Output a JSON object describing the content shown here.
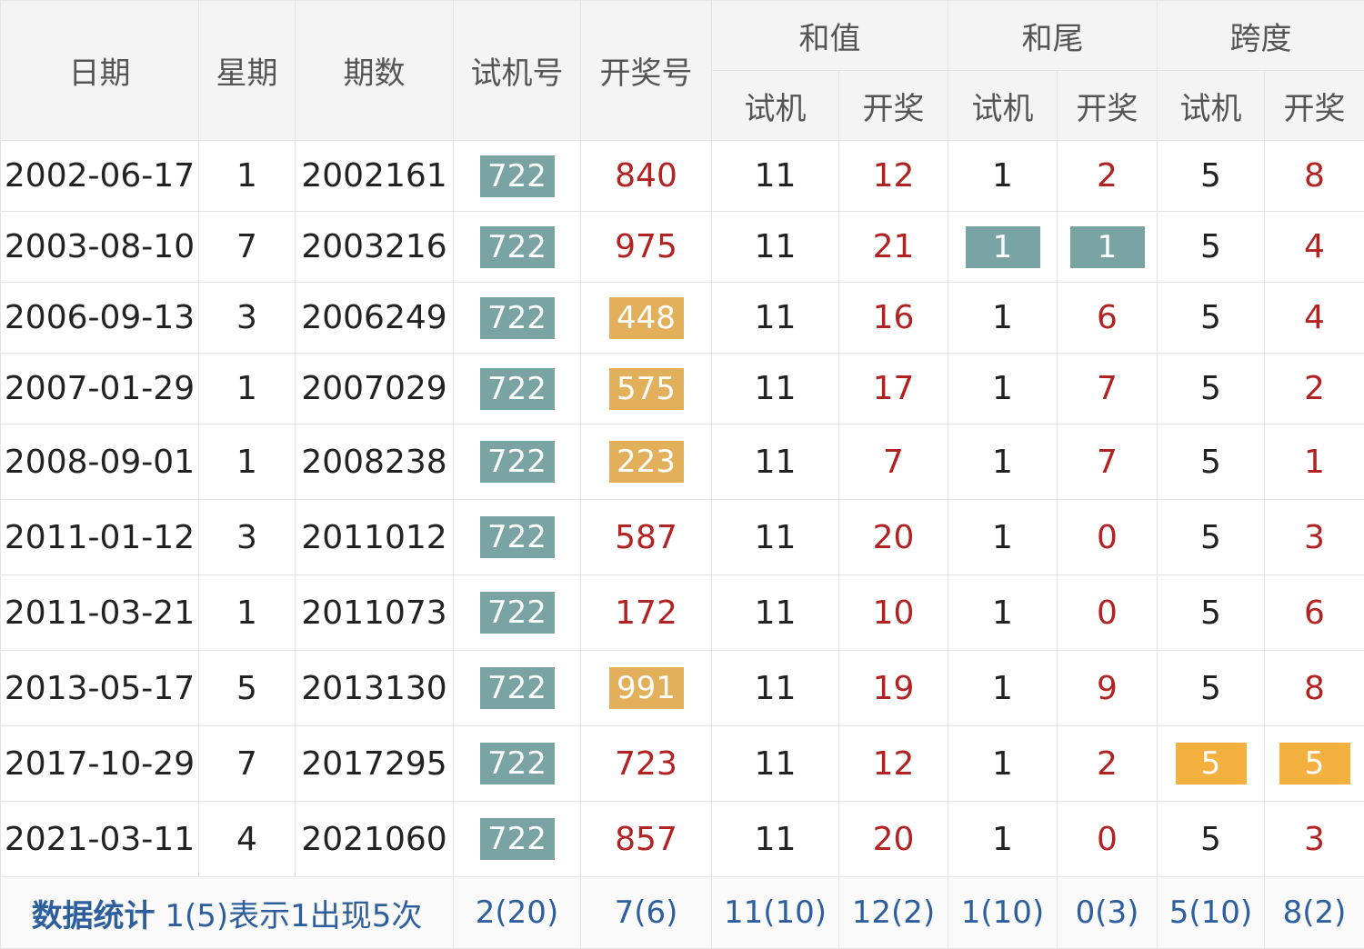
{
  "headers": {
    "date": "日期",
    "weekday": "星期",
    "issue": "期数",
    "trial_no": "试机号",
    "draw_no": "开奖号",
    "sum": "和值",
    "sum_tail": "和尾",
    "span": "跨度",
    "sub_trial": "试机",
    "sub_draw": "开奖"
  },
  "rows": [
    {
      "date": "2002-06-17",
      "weekday": "1",
      "issue": "2002161",
      "trial": "722",
      "draw": "840",
      "sum_trial": "11",
      "sum_draw": "12",
      "tail_trial": "1",
      "tail_draw": "2",
      "span_trial": "5",
      "span_draw": "8"
    },
    {
      "date": "2003-08-10",
      "weekday": "7",
      "issue": "2003216",
      "trial": "722",
      "draw": "975",
      "sum_trial": "11",
      "sum_draw": "21",
      "tail_trial": "1",
      "tail_draw": "1",
      "span_trial": "5",
      "span_draw": "4"
    },
    {
      "date": "2006-09-13",
      "weekday": "3",
      "issue": "2006249",
      "trial": "722",
      "draw": "448",
      "sum_trial": "11",
      "sum_draw": "16",
      "tail_trial": "1",
      "tail_draw": "6",
      "span_trial": "5",
      "span_draw": "4"
    },
    {
      "date": "2007-01-29",
      "weekday": "1",
      "issue": "2007029",
      "trial": "722",
      "draw": "575",
      "sum_trial": "11",
      "sum_draw": "17",
      "tail_trial": "1",
      "tail_draw": "7",
      "span_trial": "5",
      "span_draw": "2"
    },
    {
      "date": "2008-09-01",
      "weekday": "1",
      "issue": "2008238",
      "trial": "722",
      "draw": "223",
      "sum_trial": "11",
      "sum_draw": "7",
      "tail_trial": "1",
      "tail_draw": "7",
      "span_trial": "5",
      "span_draw": "1"
    },
    {
      "date": "2011-01-12",
      "weekday": "3",
      "issue": "2011012",
      "trial": "722",
      "draw": "587",
      "sum_trial": "11",
      "sum_draw": "20",
      "tail_trial": "1",
      "tail_draw": "0",
      "span_trial": "5",
      "span_draw": "3"
    },
    {
      "date": "2011-03-21",
      "weekday": "1",
      "issue": "2011073",
      "trial": "722",
      "draw": "172",
      "sum_trial": "11",
      "sum_draw": "10",
      "tail_trial": "1",
      "tail_draw": "0",
      "span_trial": "5",
      "span_draw": "6"
    },
    {
      "date": "2013-05-17",
      "weekday": "5",
      "issue": "2013130",
      "trial": "722",
      "draw": "991",
      "sum_trial": "11",
      "sum_draw": "19",
      "tail_trial": "1",
      "tail_draw": "9",
      "span_trial": "5",
      "span_draw": "8"
    },
    {
      "date": "2017-10-29",
      "weekday": "7",
      "issue": "2017295",
      "trial": "722",
      "draw": "723",
      "sum_trial": "11",
      "sum_draw": "12",
      "tail_trial": "1",
      "tail_draw": "2",
      "span_trial": "5",
      "span_draw": "5"
    },
    {
      "date": "2021-03-11",
      "weekday": "4",
      "issue": "2021060",
      "trial": "722",
      "draw": "857",
      "sum_trial": "11",
      "sum_draw": "20",
      "tail_trial": "1",
      "tail_draw": "0",
      "span_trial": "5",
      "span_draw": "3"
    }
  ],
  "stats": {
    "title": "数据统计",
    "note": "1(5)表示1出现5次",
    "trial": "2(20)",
    "draw": "7(6)",
    "sum_trial": "11(10)",
    "sum_draw": "12(2)",
    "tail_trial": "1(10)",
    "tail_draw": "0(3)",
    "span_trial": "5(10)",
    "span_draw": "8(2)"
  },
  "colors": {
    "highlight_teal": "#7aa3a3",
    "highlight_gold": "#e2b05a",
    "highlight_orange": "#f5b13f",
    "draw_red": "#b22222",
    "stat_blue": "#2d5e9e"
  }
}
